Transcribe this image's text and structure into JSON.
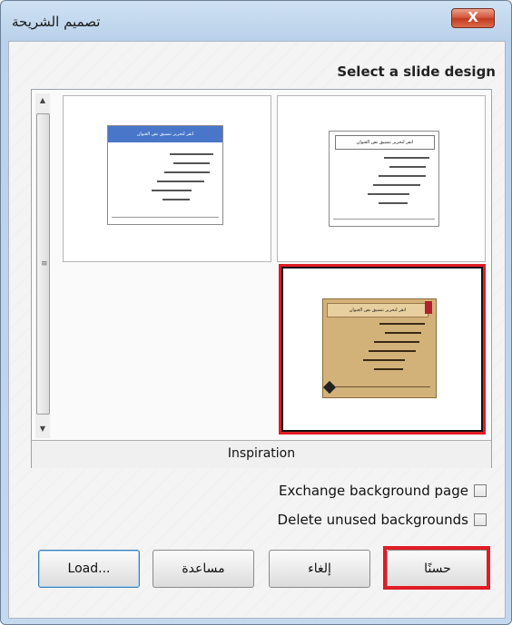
{
  "window": {
    "title": "تصميم الشريحة",
    "close_label": "X"
  },
  "heading": "Select a slide design",
  "slides": [
    {
      "title": "انقر لتحرير تنسيق نص العنوان",
      "selected": false,
      "style": "blue-header"
    },
    {
      "title": "انقر لتحرير تنسيق نص العنوان",
      "selected": false,
      "style": "plain"
    },
    {
      "title": "انقر لتحرير تنسيق نص العنوان",
      "selected": true,
      "style": "inspiration"
    }
  ],
  "selected_caption": "Inspiration",
  "options": {
    "exchange_background": {
      "label": "Exchange background page",
      "checked": false
    },
    "delete_unused": {
      "label": "Delete unused backgrounds",
      "checked": false
    }
  },
  "buttons": {
    "load": "Load...",
    "help": "مساعدة",
    "cancel": "إلغاء",
    "ok": "حسنًا"
  },
  "colors": {
    "highlight": "#e01c24",
    "title_blue": "#4a76c9",
    "inspiration_bg": "#d3b27a"
  }
}
